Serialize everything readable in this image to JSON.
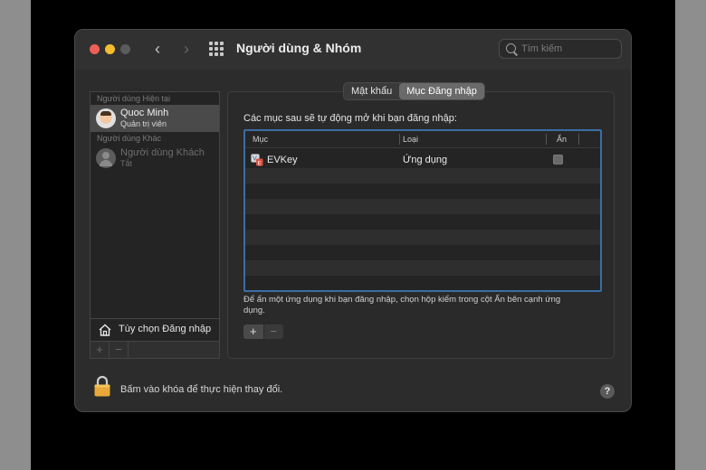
{
  "window": {
    "title": "Người dùng & Nhóm",
    "search_placeholder": "Tìm kiếm"
  },
  "sidebar": {
    "current_users_header": "Người dùng Hiện tại",
    "current_user": {
      "name": "Quoc Minh",
      "role": "Quản trị viên"
    },
    "other_users_header": "Người dùng Khác",
    "guest_user": {
      "name": "Người dùng Khách",
      "status": "Tắt"
    },
    "login_options_label": "Tùy chọn Đăng nhập",
    "add_label": "+",
    "remove_label": "−"
  },
  "tabs": [
    {
      "label": "Mật khẩu",
      "active": false
    },
    {
      "label": "Mục Đăng nhập",
      "active": true
    }
  ],
  "main": {
    "caption": "Các mục sau sẽ tự động mở khi bạn đăng nhập:",
    "columns": {
      "item": "Mục",
      "kind": "Loại",
      "hide": "Ẩn"
    },
    "rows": [
      {
        "item": "EVKey",
        "kind": "Ứng dụng",
        "hidden": false
      }
    ],
    "hint": "Để ẩn một ứng dụng khi bạn đăng nhập, chọn hộp kiểm trong cột Ẩn bên cạnh ứng dụng.",
    "add_label": "+",
    "remove_label": "−"
  },
  "footer": {
    "lock_text": "Bấm vào khóa để thực hiện thay đổi.",
    "help_label": "?"
  },
  "colors": {
    "close": "#ee5f57",
    "minimize": "#f6bc2f",
    "table_focus_border": "#3a6ea5",
    "lock": "#e8a93a"
  }
}
